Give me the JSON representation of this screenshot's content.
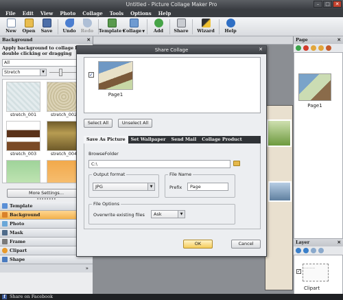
{
  "app": {
    "title": "Untitled - Picture Collage Maker Pro",
    "window_controls": [
      "–",
      "□",
      "✕"
    ]
  },
  "menu": [
    "File",
    "Edit",
    "View",
    "Photo",
    "Collage",
    "Tools",
    "Options",
    "Help"
  ],
  "toolbar": {
    "new": "New",
    "open": "Open",
    "save": "Save",
    "undo": "Undo",
    "redo": "Redo",
    "template": "Template",
    "collage": "Collage",
    "add": "Add",
    "share": "Share",
    "wizard": "Wizard",
    "help": "Help",
    "dropdown_glyph": "▼"
  },
  "left_panel": {
    "header": "Background",
    "close": "✕",
    "description": "Apply background to collage by double clicking or dragging",
    "filter_value": "All",
    "mode_value": "Stretch",
    "dropdown_glyph": "▼",
    "thumbnails": [
      {
        "label": "stretch_001",
        "color": "#e4ecee"
      },
      {
        "label": "stretch_002",
        "color": "#d6cdb0"
      },
      {
        "label": "stretch_003",
        "color": "#6a3e20"
      },
      {
        "label": "stretch_004",
        "color": "#8c7a3e"
      },
      {
        "label": "",
        "color": "#9fd39a"
      },
      {
        "label": "",
        "color": "#f2a94b"
      }
    ],
    "more_settings": "More Settings...",
    "grip": "••••••••",
    "categories": [
      {
        "label": "Template",
        "color": "#5a8fd6"
      },
      {
        "label": "Background",
        "color": "#d9822b"
      },
      {
        "label": "Photo",
        "color": "#6aa7d8"
      },
      {
        "label": "Mask",
        "color": "#4f6b8a"
      },
      {
        "label": "Frame",
        "color": "#7a7a7a"
      },
      {
        "label": "Clipart",
        "color": "#e89a2c"
      },
      {
        "label": "Shape",
        "color": "#4a7bbf"
      }
    ],
    "expand": "»"
  },
  "right_panel": {
    "pages_header": "Page",
    "pages_close": "✕",
    "page_label": "Page1",
    "layer_header": "Layer",
    "layer_close": "✕",
    "layer_label": "Clipart",
    "layer_check": "✓",
    "layer_caption": "........."
  },
  "status": {
    "text": "Share on Facebook",
    "icon": "f"
  },
  "dialog": {
    "title": "Share Collage",
    "close": "✕",
    "page_item": {
      "label": "Page1",
      "check": "✓"
    },
    "select_all": "Select All",
    "unselect_all": "Unselect All",
    "tabs": [
      "Save As Picture",
      "Set Wallpaper",
      "Send Mail",
      "Collage Product"
    ],
    "browse_label": "BrowseFolder",
    "folder_value": "C:\\",
    "output_format_title": "Output format",
    "output_format_value": "JPG",
    "file_name_title": "File Name",
    "prefix_label": "Prefix",
    "prefix_value": "Page",
    "file_options_title": "File Options",
    "overwrite_label": "Overwrite existing files",
    "overwrite_value": "Ask",
    "dropdown_glyph": "▼",
    "ok": "OK",
    "cancel": "Cancel"
  },
  "colors": {
    "accent_orange": "#f3b14c",
    "dark_chrome": "#3a3d41"
  }
}
